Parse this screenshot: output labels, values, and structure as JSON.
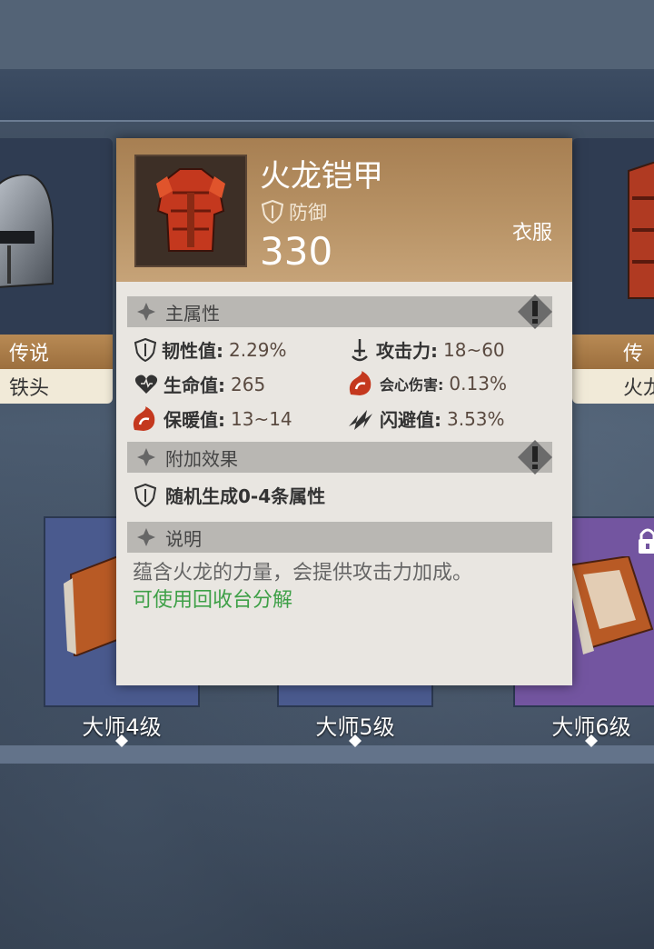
{
  "side_left": {
    "rarity": "传说",
    "name": "铁头"
  },
  "side_right": {
    "rarity": "传",
    "name": "火龙"
  },
  "masters": [
    {
      "label": "大师4级",
      "locked": false
    },
    {
      "label": "大师5级",
      "locked": false
    },
    {
      "label": "大师6级",
      "locked": true
    }
  ],
  "tooltip": {
    "title": "火龙铠甲",
    "defense_label": "防御",
    "defense_value": "330",
    "slot": "衣服",
    "main_section": "主属性",
    "attributes": [
      {
        "label": "韧性值:",
        "value": "2.29%",
        "icon": "shield-icon"
      },
      {
        "label": "攻击力:",
        "value": "18~60",
        "icon": "sword-icon"
      },
      {
        "label": "生命值:",
        "value": "265",
        "icon": "heart-icon"
      },
      {
        "label": "会心伤害:",
        "value": "0.13%",
        "icon": "crit-icon"
      },
      {
        "label": "保暖值:",
        "value": "13~14",
        "icon": "fire-icon"
      },
      {
        "label": "闪避值:",
        "value": "3.53%",
        "icon": "dodge-icon"
      }
    ],
    "extra_section": "附加效果",
    "extra_text": "随机生成0-4条属性",
    "desc_section": "说明",
    "description": "蕴含火龙的力量，会提供攻击力加成。",
    "hint": "可使用回收台分解"
  },
  "colors": {
    "header": "#b08a5c",
    "panel": "#e9e6e1",
    "hint": "#3ea047",
    "value": "#5a4a40"
  }
}
